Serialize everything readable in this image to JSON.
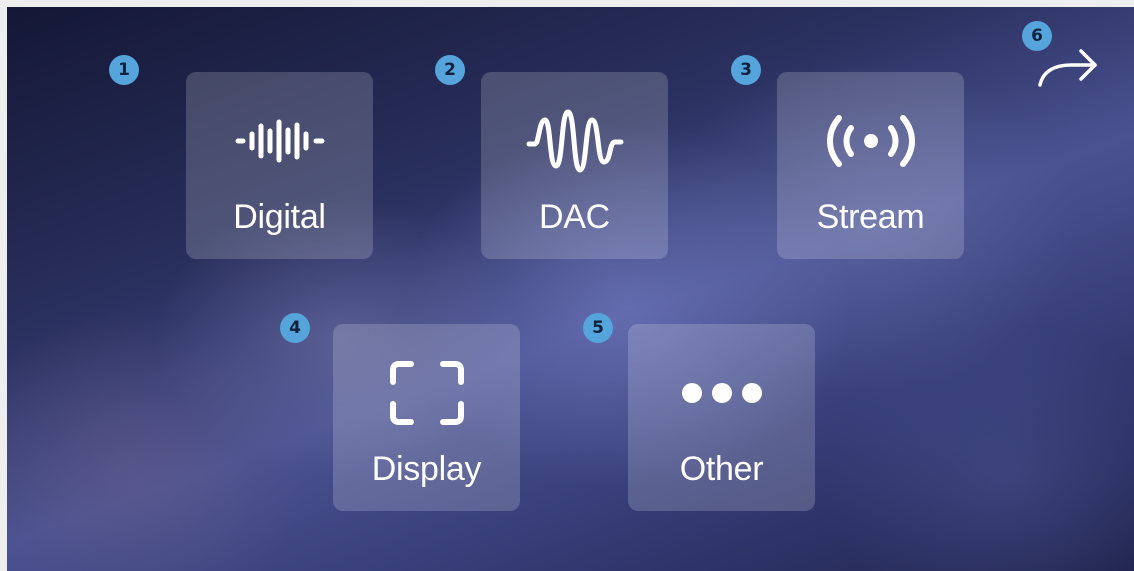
{
  "tiles": [
    {
      "label": "Digital",
      "badge": "1",
      "icon": "waveform-icon"
    },
    {
      "label": "DAC",
      "badge": "2",
      "icon": "sine-wave-icon"
    },
    {
      "label": "Stream",
      "badge": "3",
      "icon": "broadcast-icon"
    },
    {
      "label": "Display",
      "badge": "4",
      "icon": "display-frame-icon"
    },
    {
      "label": "Other",
      "badge": "5",
      "icon": "more-dots-icon"
    }
  ],
  "forward": {
    "badge": "6",
    "icon": "forward-arrow-icon"
  },
  "colors": {
    "badge": "#55a5dc",
    "tile": "rgba(255,255,255,0.18)",
    "text": "#ffffff"
  }
}
